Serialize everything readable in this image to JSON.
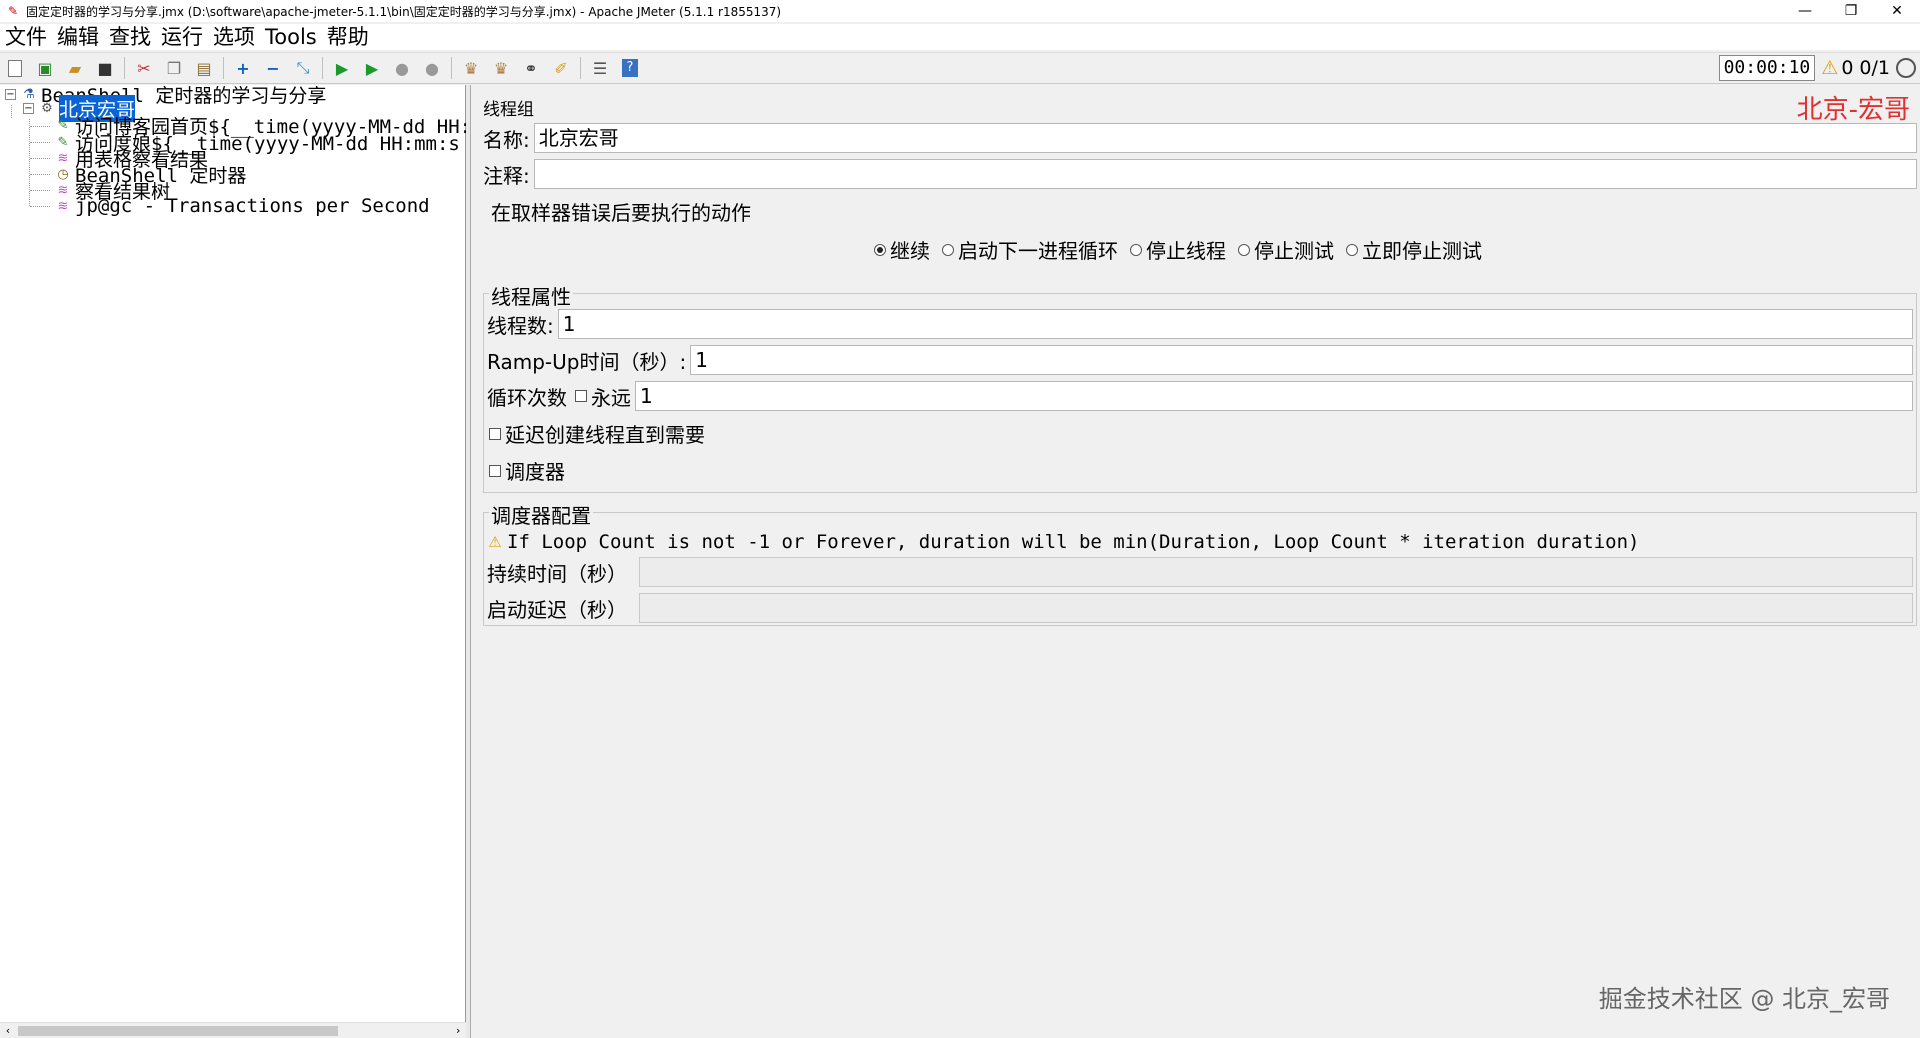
{
  "window": {
    "title": "固定定时器的学习与分享.jmx (D:\\software\\apache-jmeter-5.1.1\\bin\\固定定时器的学习与分享.jmx) - Apache JMeter (5.1.1 r1855137)",
    "minimize": "—",
    "restore": "❐",
    "close": "✕"
  },
  "menu": [
    "文件",
    "编辑",
    "查找",
    "运行",
    "选项",
    "Tools",
    "帮助"
  ],
  "toolbar": {
    "timer": "00:00:10",
    "warning_count": "0",
    "threads": "0/1"
  },
  "tree": {
    "root": "BeanShell 定时器的学习与分享",
    "selected": "北京宏哥",
    "children": [
      "访问博客园首页${__time(yyyy-MM-dd HH:",
      "访问度娘${__time(yyyy-MM-dd HH:mm:s",
      "用表格察看结果",
      "BeanShell 定时器",
      "察看结果树",
      "jp@gc - Transactions per Second"
    ]
  },
  "panel": {
    "title": "线程组",
    "brand": "北京-宏哥",
    "name_label": "名称:",
    "name_value": "北京宏哥",
    "comment_label": "注释:",
    "comment_value": "",
    "on_error_legend": "在取样器错误后要执行的动作",
    "on_error_options": [
      "继续",
      "启动下一进程循环",
      "停止线程",
      "停止测试",
      "立即停止测试"
    ],
    "on_error_selected": "继续",
    "thread_props_legend": "线程属性",
    "threads_label": "线程数:",
    "threads_value": "1",
    "rampup_label": "Ramp-Up时间（秒）:",
    "rampup_value": "1",
    "loop_label": "循环次数",
    "loop_forever_label": "永远",
    "loop_value": "1",
    "delay_label": "延迟创建线程直到需要",
    "scheduler_label": "调度器",
    "scheduler_legend": "调度器配置",
    "scheduler_warning": "If Loop Count is not -1 or Forever, duration will be min(Duration, Loop Count * iteration duration)",
    "duration_label": "持续时间（秒）",
    "duration_value": "",
    "startup_delay_label": "启动延迟（秒）",
    "startup_delay_value": ""
  },
  "watermark": "掘金技术社区 @ 北京_宏哥"
}
